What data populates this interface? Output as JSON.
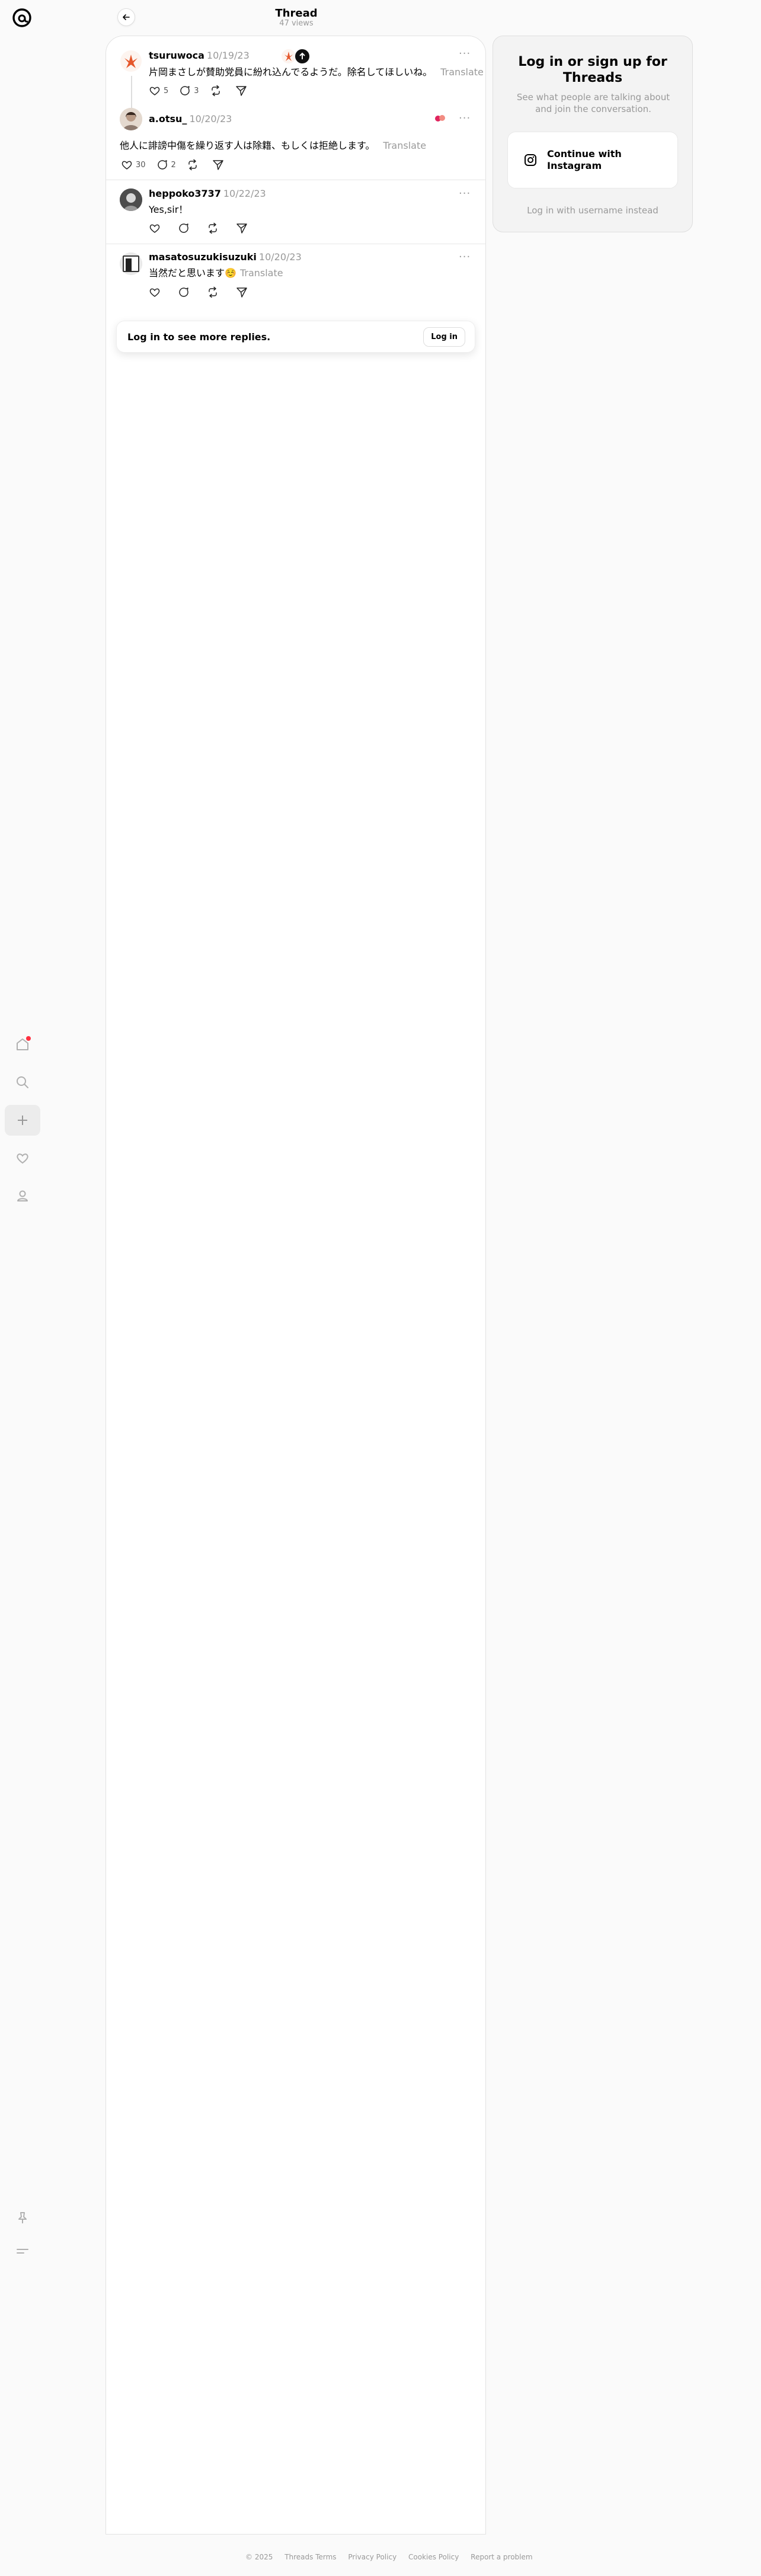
{
  "header": {
    "title": "Thread",
    "views": "47 views"
  },
  "nav": {
    "icons": [
      "threads-logo-icon",
      "home-icon",
      "search-icon",
      "create-icon",
      "activity-heart-icon",
      "profile-icon",
      "pin-icon",
      "menu-icon"
    ],
    "notification_color": "#ff3040"
  },
  "posts": [
    {
      "username": "tsuruwoca",
      "date": "10/19/23",
      "text": "片岡まさしが賛助党員に紛れ込んでるようだ。除名してほしいね。",
      "translate": "Translate",
      "likes": "5",
      "replies": "3"
    },
    {
      "username": "a.otsu_",
      "date": "10/20/23",
      "text": "他人に誹謗中傷を繰り返す人は除籍、もしくは拒絶します。",
      "translate": "Translate",
      "likes": "30",
      "replies": "2"
    },
    {
      "username": "heppoko3737",
      "date": "10/22/23",
      "text": "Yes,sir！"
    },
    {
      "username": "masatosuzukisuzuki",
      "date": "10/20/23",
      "text": "当然だと思います☺️",
      "translate": "Translate"
    }
  ],
  "login_prompt": {
    "text": "Log in to see more replies.",
    "button": "Log in"
  },
  "side": {
    "title": "Log in or sign up for Threads",
    "subtitle": "See what people are talking about and join the conversation.",
    "instagram_button": "Continue with Instagram",
    "username_link": "Log in with username instead"
  },
  "footer": [
    "© 2025",
    "Threads Terms",
    "Privacy Policy",
    "Cookies Policy",
    "Report a problem"
  ]
}
